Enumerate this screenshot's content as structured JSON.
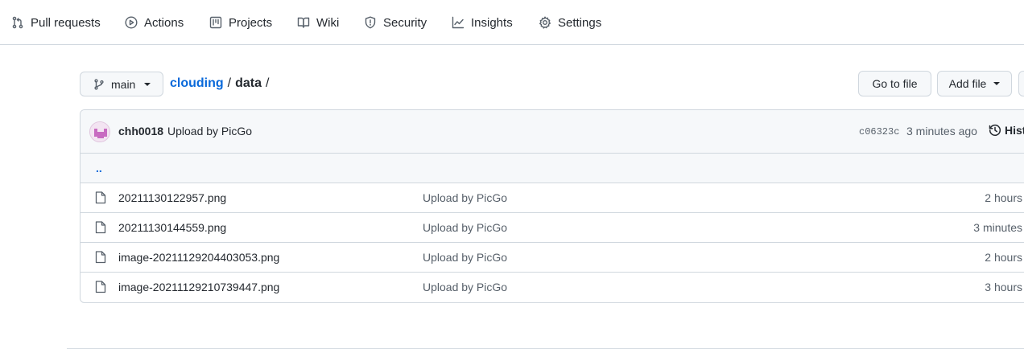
{
  "nav": {
    "items": [
      {
        "label": "Pull requests",
        "icon": "pull-request-icon"
      },
      {
        "label": "Actions",
        "icon": "play-icon"
      },
      {
        "label": "Projects",
        "icon": "project-icon"
      },
      {
        "label": "Wiki",
        "icon": "book-icon"
      },
      {
        "label": "Security",
        "icon": "shield-icon"
      },
      {
        "label": "Insights",
        "icon": "graph-icon"
      },
      {
        "label": "Settings",
        "icon": "gear-icon"
      }
    ]
  },
  "branch": {
    "name": "main"
  },
  "breadcrumb": {
    "repo": "clouding",
    "sep1": "/",
    "dir": "data",
    "sep2": "/"
  },
  "buttons": {
    "go_to_file": "Go to file",
    "add_file": "Add file"
  },
  "commit": {
    "author": "chh0018",
    "message": "Upload by PicGo",
    "sha": "c06323c",
    "time": "3 minutes ago",
    "history_label": "History"
  },
  "updir": "..",
  "files": [
    {
      "name": "20211130122957.png",
      "commit": "Upload by PicGo",
      "age": "2 hours"
    },
    {
      "name": "20211130144559.png",
      "commit": "Upload by PicGo",
      "age": "3 minutes"
    },
    {
      "name": "image-20211129204403053.png",
      "commit": "Upload by PicGo",
      "age": "2 hours"
    },
    {
      "name": "image-20211129210739447.png",
      "commit": "Upload by PicGo",
      "age": "3 hours"
    }
  ],
  "colors": {
    "link": "#0969da",
    "border": "#d0d7de",
    "muted": "#57606a",
    "header_bg": "#f6f8fa"
  }
}
